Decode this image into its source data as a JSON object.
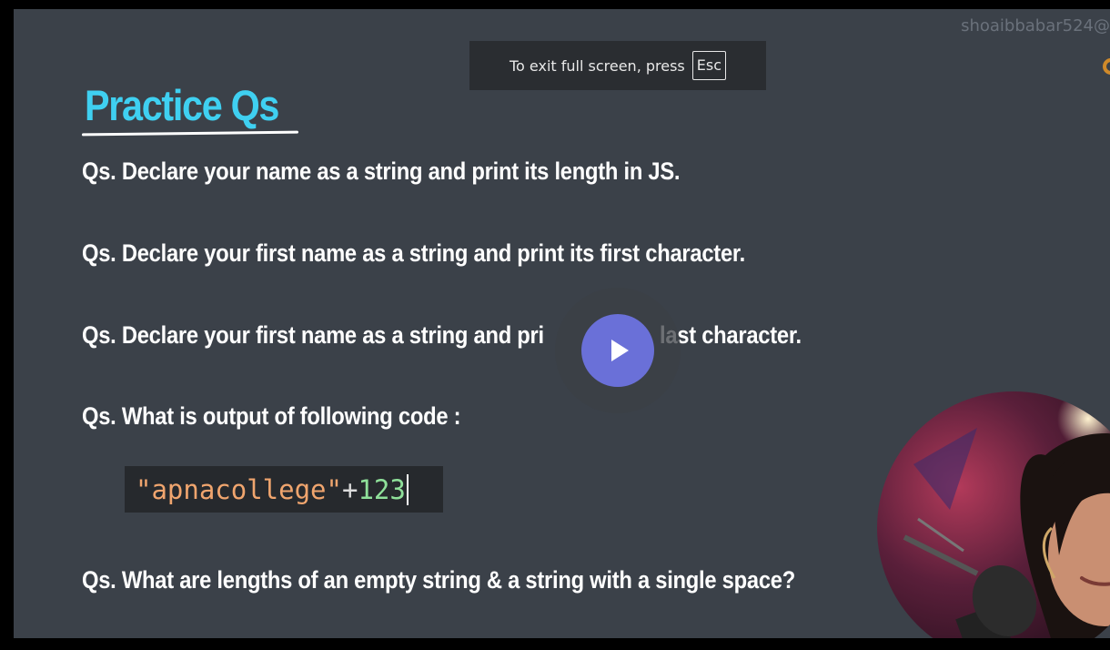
{
  "overlay": {
    "watermark": "shoaibbabar524@",
    "fullscreen_message": "To exit full screen, press",
    "esc_key": "Esc"
  },
  "slide": {
    "title": "Practice Qs",
    "questions": [
      "Qs. Declare your name as a string and print its length in JS.",
      "Qs. Declare your first name as a string and print its first character.",
      "Qs. Declare your first name as a string and pri",
      "last character.",
      "Qs. What is output of following code :",
      "Qs. What are lengths of an empty string & a string with a single space?"
    ],
    "code": {
      "string_part": "\"apnacollege\"",
      "operator": "+",
      "number_part": "123"
    }
  },
  "player": {
    "play_icon": "play-icon",
    "accent": "#6a70d8"
  },
  "colors": {
    "title": "#3fd0f1",
    "background": "#3b4149",
    "code_string": "#f0a56e",
    "code_number": "#8fe09a"
  }
}
